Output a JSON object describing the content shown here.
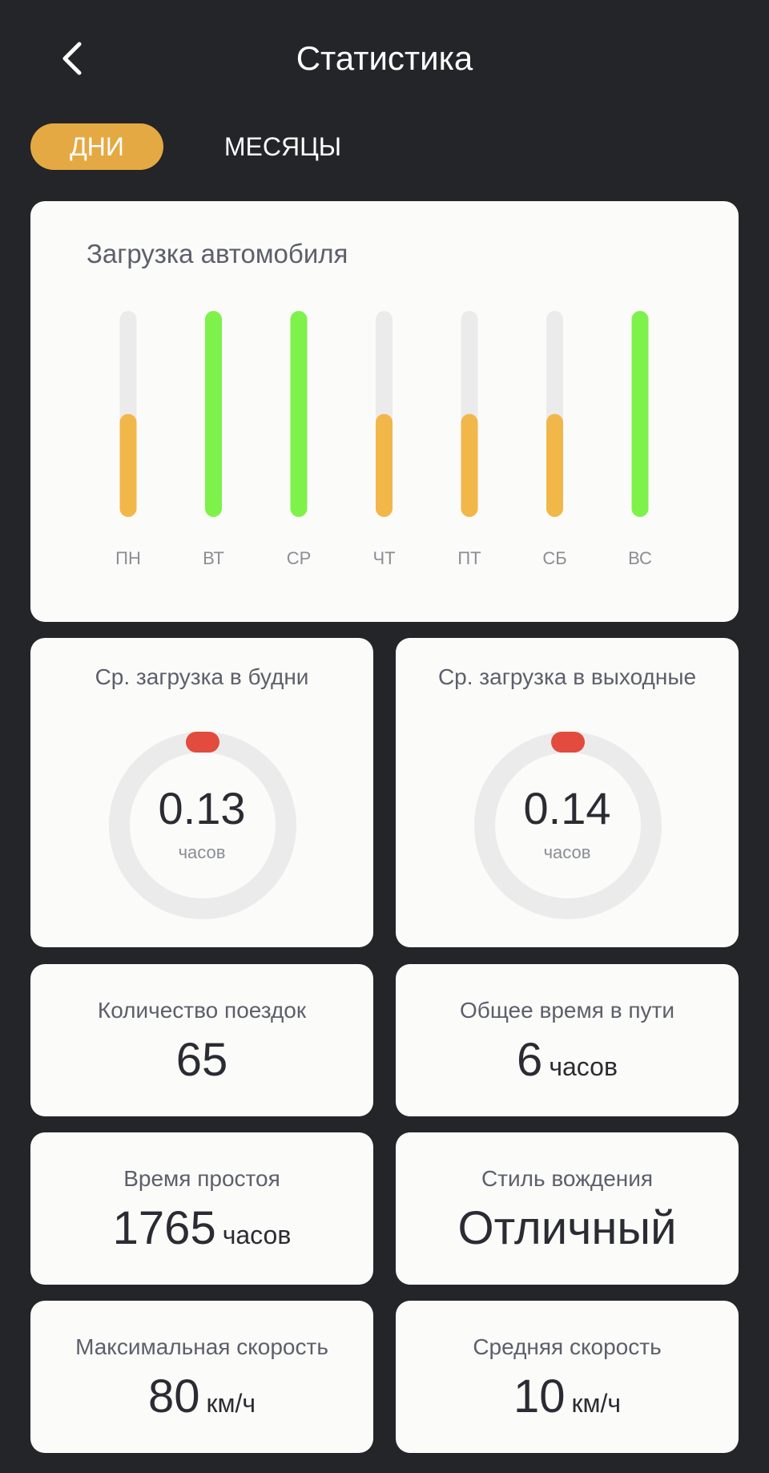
{
  "header": {
    "title": "Статистика",
    "back_icon": "chevron-left-icon"
  },
  "tabs": [
    {
      "label": "ДНИ",
      "active": true
    },
    {
      "label": "МЕСЯЦЫ",
      "active": false
    }
  ],
  "chart_data": {
    "type": "bar",
    "title": "Загрузка автомобиля",
    "categories": [
      "ПН",
      "ВТ",
      "СР",
      "ЧТ",
      "ПТ",
      "СБ",
      "ВС"
    ],
    "values": [
      0.5,
      1.0,
      1.0,
      0.5,
      0.5,
      0.5,
      1.0
    ],
    "ylim": [
      0,
      1
    ],
    "colors": [
      "#f2b749",
      "#7ef24a",
      "#7ef24a",
      "#f2b749",
      "#f2b749",
      "#f2b749",
      "#7ef24a"
    ],
    "track_color": "#ebebeb"
  },
  "gauges": {
    "weekdays": {
      "title": "Ср. загрузка в будни",
      "value": "0.13",
      "unit": "часов",
      "indicator_color": "#e24b3d"
    },
    "weekends": {
      "title": "Ср. загрузка в выходные",
      "value": "0.14",
      "unit": "часов",
      "indicator_color": "#e24b3d"
    }
  },
  "stats": {
    "trips": {
      "title": "Количество поездок",
      "value": "65",
      "unit": ""
    },
    "travel_time": {
      "title": "Общее время в пути",
      "value": "6",
      "unit": "часов"
    },
    "idle_time": {
      "title": "Время простоя",
      "value": "1765",
      "unit": "часов"
    },
    "driving_style": {
      "title": "Стиль вождения",
      "value": "Отличный",
      "unit": ""
    },
    "max_speed": {
      "title": "Максимальная скорость",
      "value": "80",
      "unit": "км/ч"
    },
    "avg_speed": {
      "title": "Средняя скорость",
      "value": "10",
      "unit": "км/ч"
    }
  },
  "colors": {
    "background": "#232528",
    "accent": "#e4a942",
    "card": "#fbfbf9"
  }
}
